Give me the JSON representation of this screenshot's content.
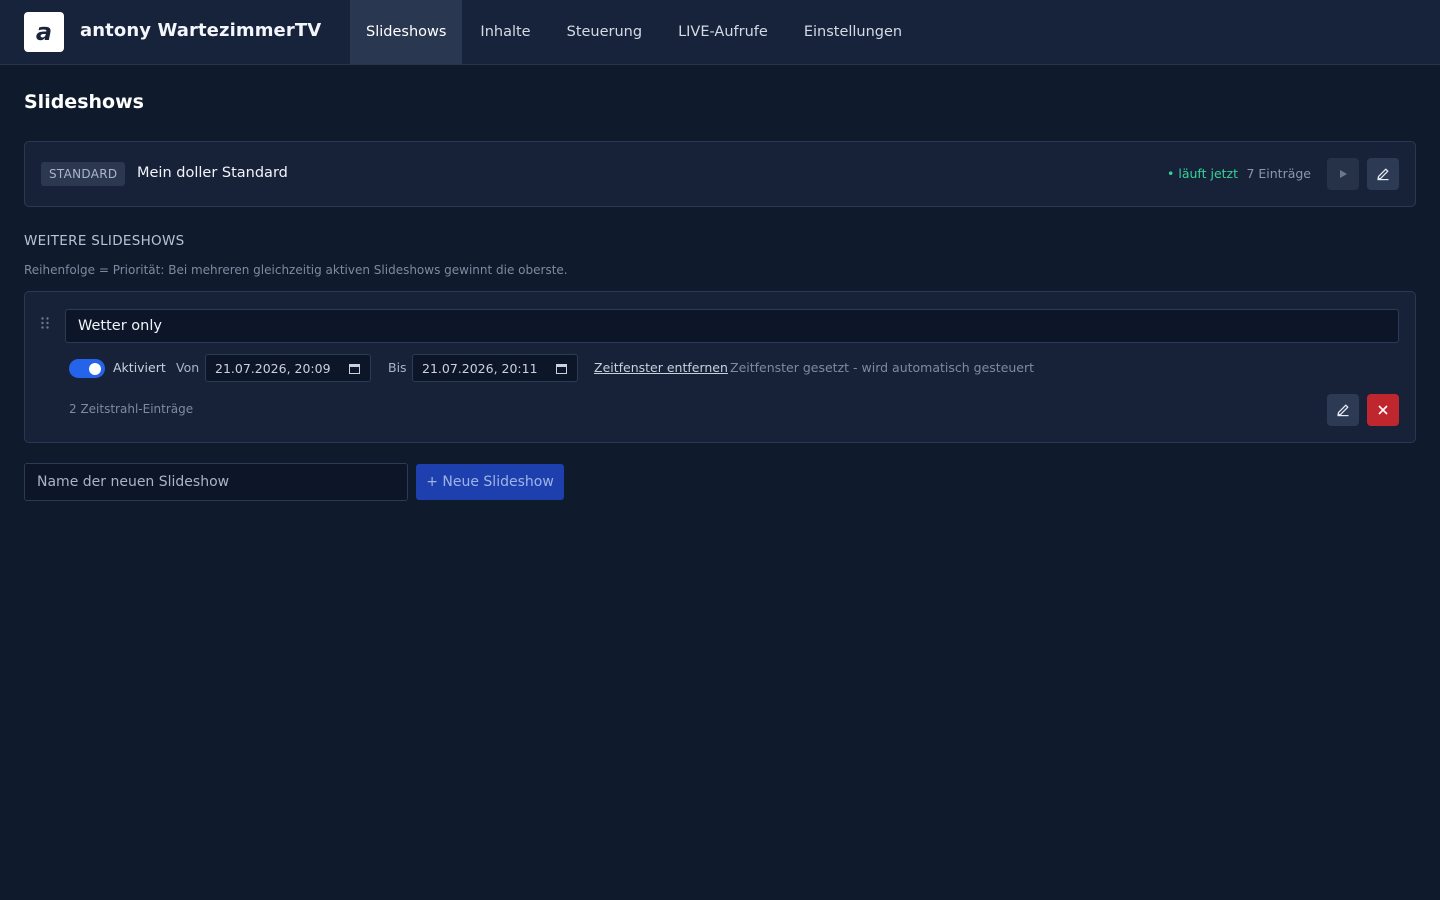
{
  "app": {
    "logo_letter": "a",
    "title": "antony WartezimmerTV"
  },
  "nav": {
    "items": [
      {
        "label": "Slideshows",
        "active": true
      },
      {
        "label": "Inhalte",
        "active": false
      },
      {
        "label": "Steuerung",
        "active": false
      },
      {
        "label": "LIVE-Aufrufe",
        "active": false
      },
      {
        "label": "Einstellungen",
        "active": false
      }
    ]
  },
  "page": {
    "title": "Slideshows"
  },
  "standard": {
    "badge": "STANDARD",
    "name": "Mein doller Standard",
    "status": "• läuft jetzt",
    "entries": "7 Einträge",
    "status_color": "#34d399"
  },
  "more": {
    "heading": "WEITERE SLIDESHOWS",
    "hint": "Reihenfolge = Priorität: Bei mehreren gleichzeitig aktiven Slideshows gewinnt die oberste."
  },
  "slideshow": {
    "name": "Wetter only",
    "enabled": true,
    "enabled_label": "Aktiviert",
    "from_label": "Von",
    "from_value": "21.07.2026, 20:09",
    "to_label": "Bis",
    "to_value": "21.07.2026, 20:11",
    "remove_window_label": "Zeitfenster entfernen",
    "auto_hint": "Zeitfenster gesetzt - wird automatisch gesteuert",
    "timeline_count": "2 Zeitstrahl-Einträge"
  },
  "create": {
    "placeholder": "Name der neuen Slideshow",
    "button_label": "+ Neue Slideshow"
  },
  "colors": {
    "background": "#0f1a2d",
    "accent": "#2563eb",
    "danger": "#c0262d"
  }
}
